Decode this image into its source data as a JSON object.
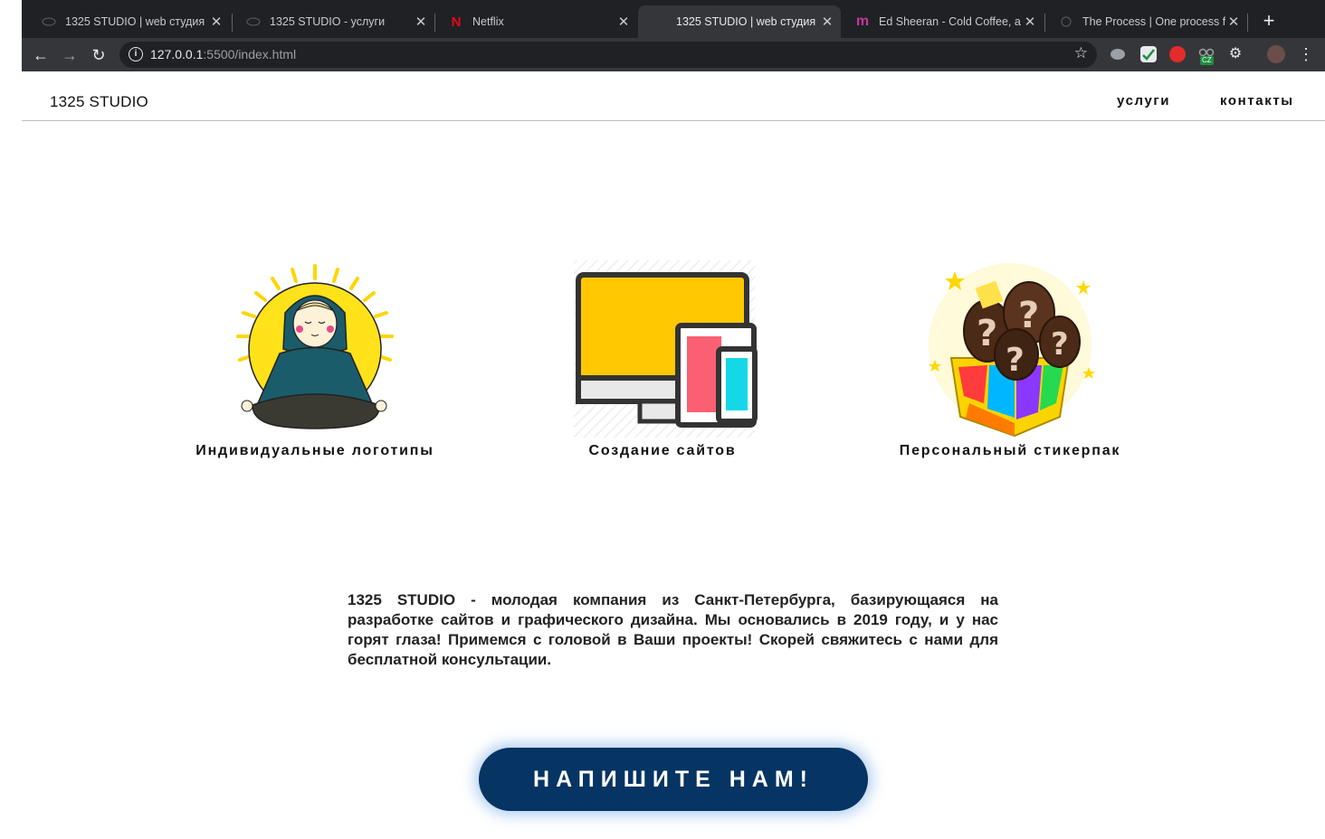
{
  "browser": {
    "tabs": [
      {
        "title": "1325 STUDIO | web студия",
        "icon": "eye-icon"
      },
      {
        "title": "1325 STUDIO - услуги",
        "icon": "eye-icon"
      },
      {
        "title": "Netflix",
        "icon": "netflix-icon",
        "favicon": "N"
      },
      {
        "title": "1325 STUDIO | web студия",
        "icon": "blank-icon",
        "active": true
      },
      {
        "title": "Ed Sheeran - Cold Coffee, a",
        "icon": "music-icon",
        "favicon": "m"
      },
      {
        "title": "The Process | One process f",
        "icon": "process-icon"
      }
    ],
    "url_host": "127.0.0.1",
    "url_path": ":5500/index.html",
    "extension_badge": "CZ"
  },
  "site": {
    "logo": "1325 STUDIO",
    "nav": {
      "services": "услуги",
      "contacts": "контакты"
    },
    "services": [
      {
        "caption": "Индивидуальные логотипы",
        "icon": "meditating-girl-icon"
      },
      {
        "caption": "Создание сайтов",
        "icon": "devices-icon"
      },
      {
        "caption": "Персональный стикерпак",
        "icon": "gift-box-icon"
      }
    ],
    "about": "1325 STUDIO - молодая компания из Санкт-Петербурга, базирующаяся на разработке сайтов и графического дизайна. Мы основались в 2019 году, и у нас горят глаза! Примемся с головой в Ваши проекты! Скорей свяжитесь с нами для бесплатной консультации.",
    "cta": "НАПИШИТЕ НАМ!"
  },
  "colors": {
    "chrome_bg": "#202124",
    "toolbar_bg": "#35363a",
    "cta_bg": "#063463",
    "accent_yellow": "#ffcc00"
  }
}
